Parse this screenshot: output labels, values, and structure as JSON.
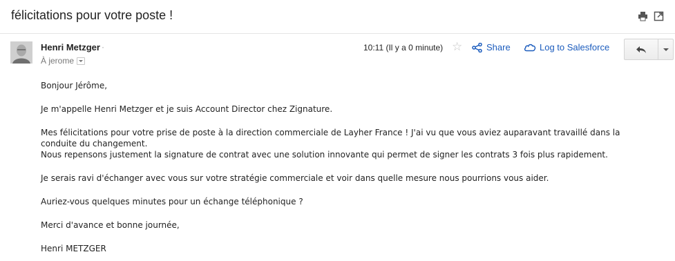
{
  "email": {
    "subject": "félicitations pour votre poste !",
    "sender": {
      "name": "Henri Metzger",
      "dot": "·",
      "to": "À jerome"
    },
    "time": "10:11 (Il y a 0 minute)",
    "actions": {
      "share": "Share",
      "salesforce": "Log to Salesforce"
    },
    "body": {
      "greeting": "Bonjour Jérôme,",
      "intro": "Je m'appelle Henri Metzger et je suis Account Director chez Zignature.",
      "para_line1": "Mes félicitations pour votre prise de poste à la direction commerciale de Layher France ! J'ai vu que vous aviez auparavant travaillé dans la",
      "para_line2": "conduite du changement.",
      "para_line3": "Nous repensons justement la signature de contrat avec une solution innovante qui permet de signer les contrats 3 fois plus rapidement.",
      "strategy": "Je serais ravi d'échanger avec vous sur votre stratégie commerciale et voir dans quelle mesure nous pourrions vous aider.",
      "question": "Auriez-vous quelques minutes pour un échange téléphonique ?",
      "thanks": "Merci d'avance et bonne journée,",
      "signature": "Henri METZGER"
    }
  },
  "colors": {
    "link": "#1a5bbd",
    "divider": "#e5e5e5"
  }
}
